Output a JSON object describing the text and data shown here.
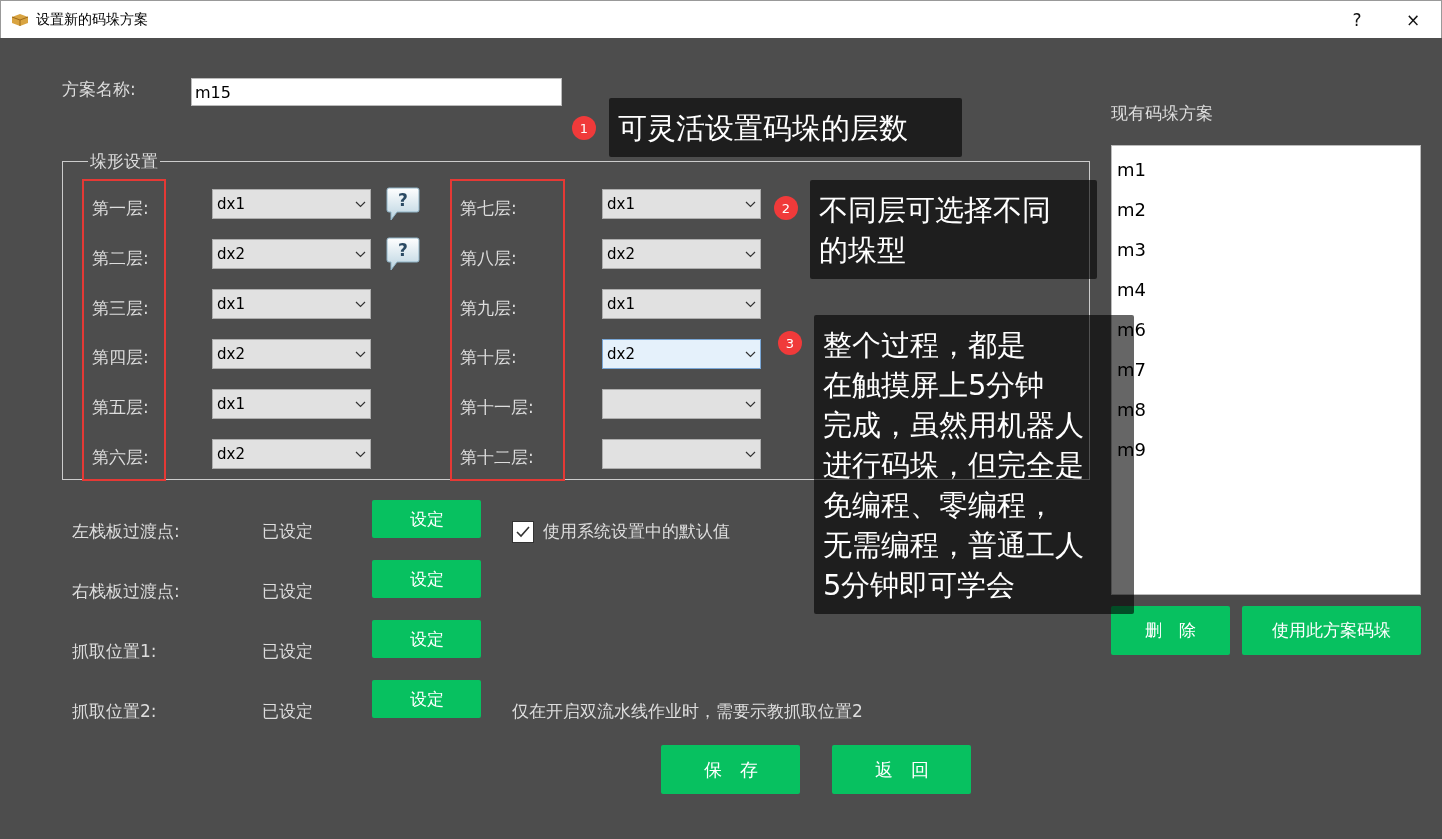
{
  "window": {
    "title": "设置新的码垛方案",
    "help_button": "?",
    "close_button": "×"
  },
  "scheme_name": {
    "label": "方案名称:",
    "value": "m15"
  },
  "stack_shape": {
    "title": "垛形设置",
    "columns": [
      [
        {
          "label": "第一层:",
          "value": "dx1",
          "help": "?",
          "focused": false
        },
        {
          "label": "第二层:",
          "value": "dx2",
          "help": "?",
          "focused": false
        },
        {
          "label": "第三层:",
          "value": "dx1",
          "focused": false
        },
        {
          "label": "第四层:",
          "value": "dx2",
          "focused": false
        },
        {
          "label": "第五层:",
          "value": "dx1",
          "focused": false
        },
        {
          "label": "第六层:",
          "value": "dx2",
          "focused": false
        }
      ],
      [
        {
          "label": "第七层:",
          "value": "dx1",
          "focused": false
        },
        {
          "label": "第八层:",
          "value": "dx2",
          "focused": false
        },
        {
          "label": "第九层:",
          "value": "dx1",
          "focused": false
        },
        {
          "label": "第十层:",
          "value": "dx2",
          "focused": true
        },
        {
          "label": "第十一层:",
          "focused": false
        },
        {
          "label": "第十二层:",
          "focused": false
        }
      ]
    ]
  },
  "points": [
    {
      "label": "左栈板过渡点:",
      "status": "已设定",
      "button": "设定",
      "option": {
        "kind": "checkbox",
        "label": "使用系统设置中的默认值",
        "checked": true
      }
    },
    {
      "label": "右栈板过渡点:",
      "status": "已设定",
      "button": "设定"
    },
    {
      "label": "抓取位置1:",
      "status": "已设定",
      "button": "设定"
    },
    {
      "label": "抓取位置2:",
      "status": "已设定",
      "button": "设定",
      "option": {
        "kind": "note",
        "text": "仅在开启双流水线作业时，需要示教抓取位置2"
      }
    }
  ],
  "actions": [
    "保　存",
    "返　回"
  ],
  "saved_schemes": {
    "title": "现有码垛方案",
    "items": [
      "m1",
      "m2",
      "m3",
      "m4",
      "m6",
      "m7",
      "m8",
      "m9"
    ],
    "buttons": [
      "删　除",
      "使用此方案码垛"
    ]
  },
  "callouts": [
    {
      "number": "1",
      "lines": [
        "可灵活设置码垛的层数"
      ]
    },
    {
      "number": "2",
      "lines": [
        "不同层可选择不同",
        "的垛型"
      ]
    },
    {
      "number": "3",
      "lines": [
        "整个过程，都是",
        "在触摸屏上5分钟",
        "完成，虽然用机器人",
        "进行码垛，但完全是",
        "免编程、零编程，",
        "无需编程，普通工人",
        "5分钟即可学会"
      ]
    }
  ]
}
